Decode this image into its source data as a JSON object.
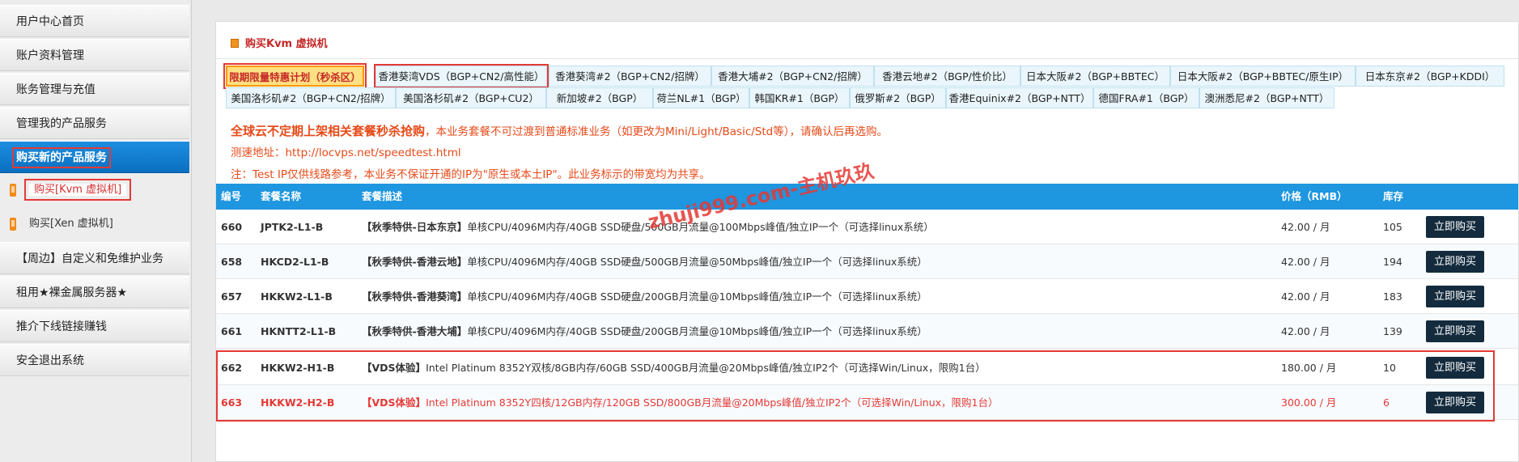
{
  "sidebar": {
    "items": [
      {
        "label": "用户中心首页"
      },
      {
        "label": "账户资料管理"
      },
      {
        "label": "账务管理与充值"
      },
      {
        "label": "管理我的产品服务"
      },
      {
        "label": "购买新的产品服务"
      },
      {
        "label": "【周边】自定义和免维护业务"
      },
      {
        "label": "租用★裸金属服务器★"
      },
      {
        "label": "推介下线链接赚钱"
      },
      {
        "label": "安全退出系统"
      }
    ],
    "subs": [
      {
        "label": "购买[Kvm 虚拟机]"
      },
      {
        "label": "购买[Xen 虚拟机]"
      }
    ]
  },
  "panel": {
    "title": "购买Kvm 虚拟机"
  },
  "tabs": [
    "限期限量特惠计划（秒杀区）",
    "香港葵湾VDS（BGP+CN2/高性能）",
    "香港葵湾#2（BGP+CN2/招牌）",
    "香港大埔#2（BGP+CN2/招牌）",
    "香港云地#2（BGP/性价比）",
    "日本大阪#2（BGP+BBTEC）",
    "日本大阪#2（BGP+BBTEC/原生IP）",
    "日本东京#2（BGP+KDDI）",
    "美国洛杉矶#2（BGP+CN2/招牌）",
    "美国洛杉矶#2（BGP+CU2）",
    "新加坡#2（BGP）",
    "荷兰NL#1（BGP）",
    "韩国KR#1（BGP）",
    "俄罗斯#2（BGP）",
    "香港Equinix#2（BGP+NTT）",
    "德国FRA#1（BGP）",
    "澳洲悉尼#2（BGP+NTT）"
  ],
  "notices": {
    "line1_bold": "全球云不定期上架相关套餐秒杀抢购",
    "line1_rest": "，本业务套餐不可过渡到普通标准业务（如更改为Mini/Light/Basic/Std等），请确认后再选购。",
    "line2": "测速地址：http://locvps.net/speedtest.html",
    "line3": "注：Test IP仅供线路参考，本业务不保证开通的IP为\"原生或本土IP\"。此业务标示的带宽均为共享。"
  },
  "watermark": "zhuji999.com-主机玖玖",
  "table": {
    "headers": {
      "id": "编号",
      "name": "套餐名称",
      "desc": "套餐描述",
      "price": "价格（RMB）",
      "stock": "库存"
    },
    "buy_label": "立即购买",
    "rows": [
      {
        "id": "660",
        "name": "JPTK2-L1-B",
        "tag": "【秋季特供-日本东京】",
        "desc": "单核CPU/4096M内存/40GB SSD硬盘/500GB月流量@100Mbps峰值/独立IP一个（可选择linux系统）",
        "price": "42.00 / 月",
        "stock": "105"
      },
      {
        "id": "658",
        "name": "HKCD2-L1-B",
        "tag": "【秋季特供-香港云地】",
        "desc": "单核CPU/4096M内存/40GB SSD硬盘/500GB月流量@50Mbps峰值/独立IP一个（可选择linux系统）",
        "price": "42.00 / 月",
        "stock": "194"
      },
      {
        "id": "657",
        "name": "HKKW2-L1-B",
        "tag": "【秋季特供-香港葵湾】",
        "desc": "单核CPU/4096M内存/40GB SSD硬盘/200GB月流量@10Mbps峰值/独立IP一个（可选择linux系统）",
        "price": "42.00 / 月",
        "stock": "183"
      },
      {
        "id": "661",
        "name": "HKNTT2-L1-B",
        "tag": "【秋季特供-香港大埔】",
        "desc": "单核CPU/4096M内存/40GB SSD硬盘/200GB月流量@10Mbps峰值/独立IP一个（可选择linux系统）",
        "price": "42.00 / 月",
        "stock": "139"
      },
      {
        "id": "662",
        "name": "HKKW2-H1-B",
        "tag": "【VDS体验】",
        "desc": "Intel Platinum 8352Y双核/8GB内存/60GB SSD/400GB月流量@20Mbps峰值/独立IP2个（可选择Win/Linux，限购1台）",
        "price": "180.00 / 月",
        "stock": "10"
      },
      {
        "id": "663",
        "name": "HKKW2-H2-B",
        "tag": "【VDS体验】",
        "desc": "Intel Platinum 8352Y四核/12GB内存/120GB SSD/800GB月流量@20Mbps峰值/独立IP2个（可选择Win/Linux，限购1台）",
        "price": "300.00 / 月",
        "stock": "6"
      }
    ]
  },
  "colors": {
    "accent": "#1e96e0",
    "highlight_red": "#e53935",
    "notice_orange": "#e64a19",
    "button_dark": "#142b3d"
  }
}
